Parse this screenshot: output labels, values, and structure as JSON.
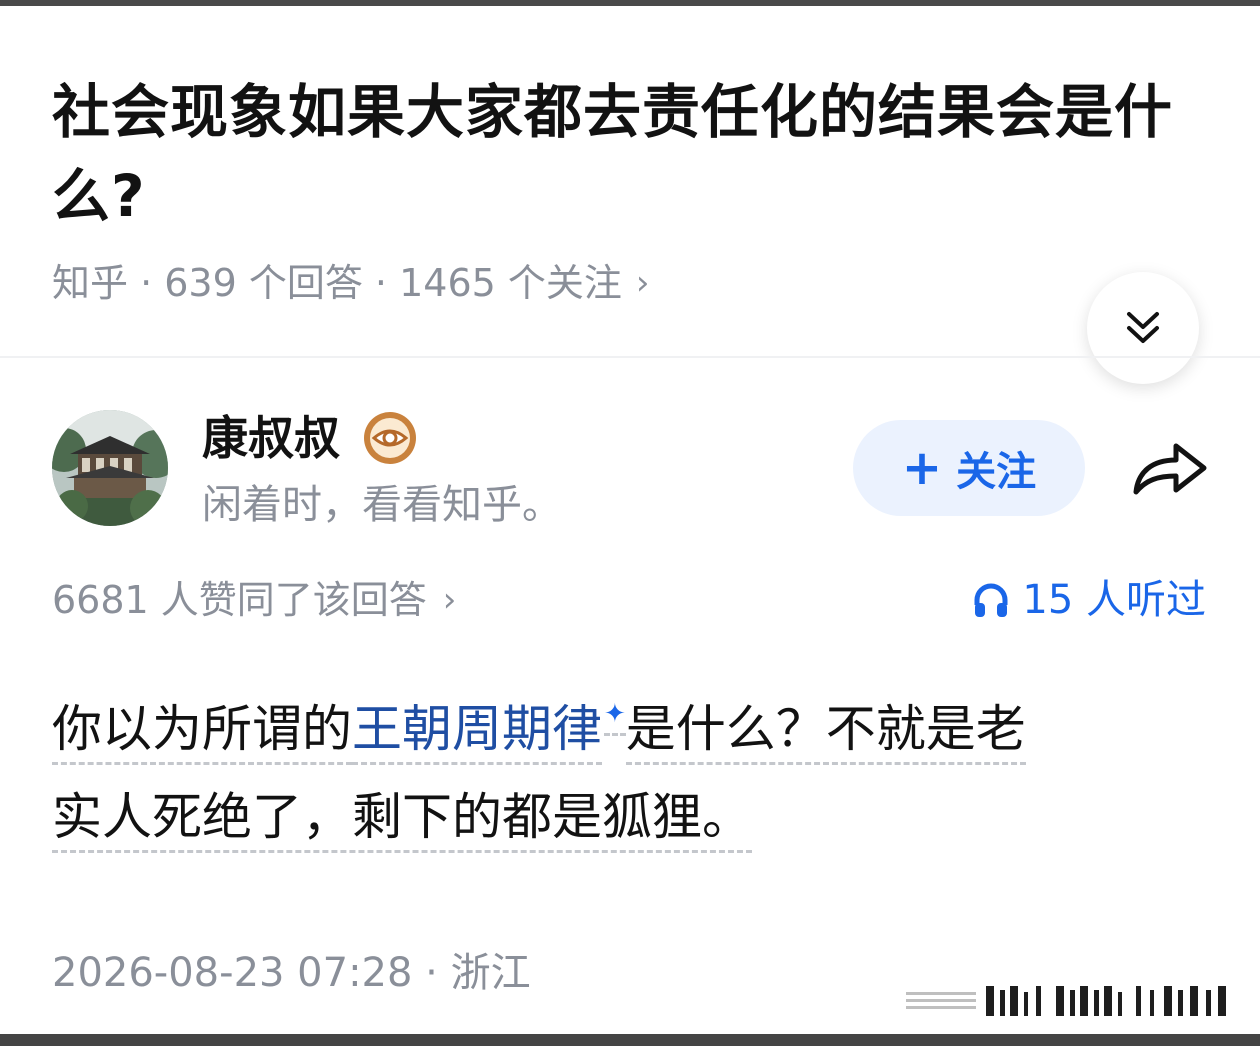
{
  "question": {
    "title": "社会现象如果大家都去责任化的结果会是什么?",
    "meta": "知乎 · 639 个回答 · 1465 个关注",
    "meta_chevron": "›"
  },
  "author": {
    "name": "康叔叔",
    "bio": "闲着时，看看知乎。",
    "badge_icon": "eye-badge-icon"
  },
  "actions": {
    "follow_plus": "+",
    "follow_label": "关注",
    "share_icon": "share-arrow-icon",
    "collapse_icon": "double-chevron-down-icon"
  },
  "answer": {
    "upvote_summary": "6681 人赞同了该回答",
    "upvote_chevron": "›",
    "listen_count": "15 人听过",
    "listen_icon": "headphones-icon",
    "body_part1": "你以为所谓的",
    "body_link": "王朝周期律",
    "body_spark": "✦",
    "body_part2": "是什么？不就是老",
    "body_line2": "实人死绝了，剩下的都是狐狸。",
    "timestamp_location": "2026-08-23 07:28 · 浙江"
  },
  "colors": {
    "accent_blue": "#1a66e8",
    "link_blue": "#1f4ea3",
    "muted_gray": "#8a8f99",
    "follow_bg": "#ebf2fe"
  }
}
